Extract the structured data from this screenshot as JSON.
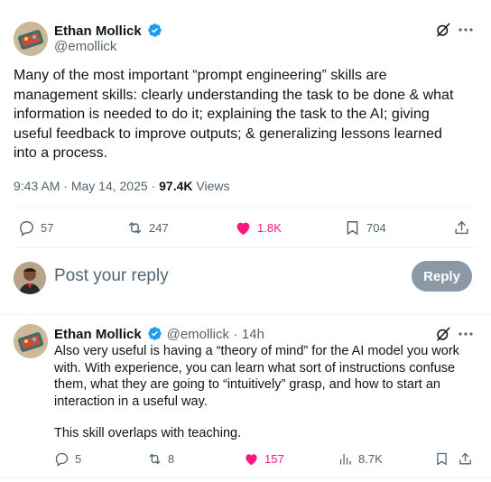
{
  "main_tweet": {
    "author_name": "Ethan Mollick",
    "handle": "@emollick",
    "text": "Many of the most important “prompt engineering” skills are management skills: clearly understanding the task to be done & what information is needed to do it; explaining the task to the AI; giving useful feedback to improve outputs; & generalizing lessons learned into a process.",
    "time": "9:43 AM",
    "date": "May 14, 2025",
    "views_count": "97.4K",
    "views_label": "Views",
    "replies": "57",
    "reposts": "247",
    "likes": "1.8K",
    "bookmarks": "704"
  },
  "composer": {
    "placeholder": "Post your reply",
    "reply_label": "Reply"
  },
  "reply_tweet": {
    "author_name": "Ethan Mollick",
    "handle": "@emollick",
    "age": "14h",
    "text_p1": "Also very useful is having a “theory of mind” for the AI model you work with. With experience, you can learn what sort of instructions confuse them, what they are going to “intuitively” grasp, and how to start an interaction in a useful way.",
    "text_p2": "This skill overlaps with teaching.",
    "replies": "5",
    "reposts": "8",
    "likes": "157",
    "views": "8.7K"
  },
  "colors": {
    "like_pink": "#f91880",
    "verified_blue": "#1d9bf0",
    "muted": "#536471",
    "reply_button_disabled": "#8b98a5"
  },
  "icons": [
    "verified-icon",
    "grok-icon",
    "more-icon",
    "reply-icon",
    "repost-icon",
    "like-icon",
    "bookmark-icon",
    "share-icon",
    "views-icon"
  ]
}
